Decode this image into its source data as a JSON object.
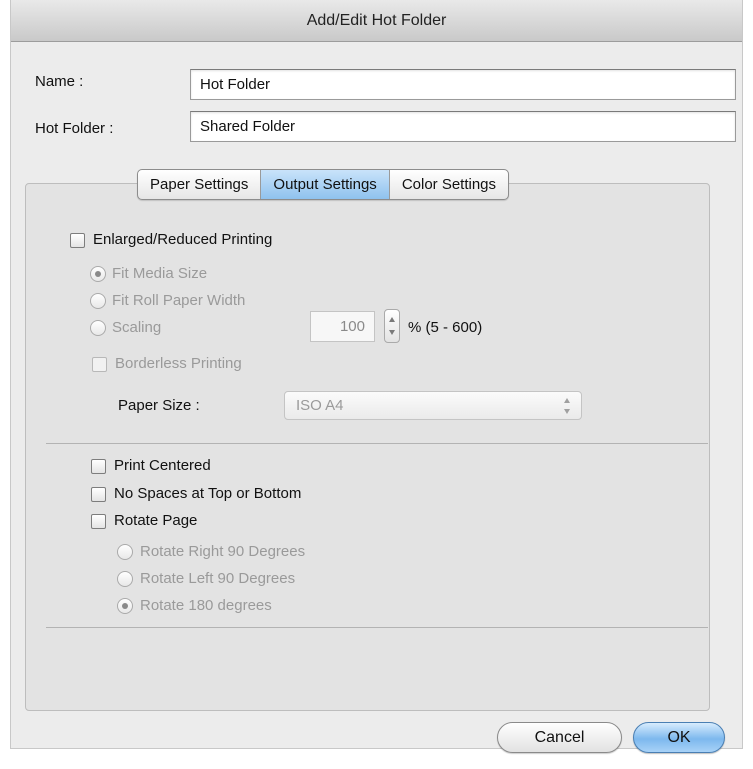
{
  "window": {
    "title": "Add/Edit Hot Folder"
  },
  "fields": {
    "name_label": "Name :",
    "name_value": "Hot Folder",
    "hot_folder_label": "Hot Folder :",
    "hot_folder_value": "Shared Folder"
  },
  "tabs": [
    {
      "label": "Paper Settings",
      "selected": false
    },
    {
      "label": "Output Settings",
      "selected": true
    },
    {
      "label": "Color Settings",
      "selected": false
    }
  ],
  "output": {
    "enlarged_label": "Enlarged/Reduced Printing",
    "enlarged_checked": false,
    "fit_media_label": "Fit Media Size",
    "fit_roll_label": "Fit Roll Paper Width",
    "scaling_label": "Scaling",
    "scaling_value": "100",
    "scaling_range": "% (5 - 600)",
    "borderless_label": "Borderless Printing",
    "paper_size_label": "Paper Size :",
    "paper_size_value": "ISO A4",
    "print_centered_label": "Print Centered",
    "no_spaces_label": "No Spaces at Top or Bottom",
    "rotate_page_label": "Rotate Page",
    "rotate_right_label": "Rotate Right 90 Degrees",
    "rotate_left_label": "Rotate Left 90 Degrees",
    "rotate_180_label": "Rotate 180 degrees"
  },
  "buttons": {
    "cancel": "Cancel",
    "ok": "OK"
  },
  "colors": {
    "selected_tab": "#9fcbf2",
    "default_button": "#7db8ee"
  }
}
